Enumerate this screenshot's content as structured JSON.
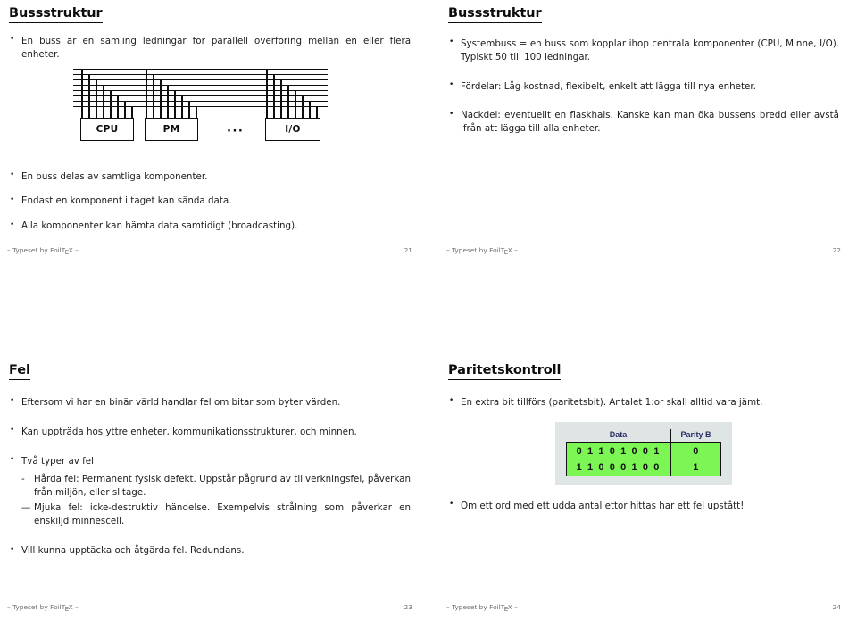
{
  "slides": [
    {
      "id": "bussstruktur-1",
      "title": "Bussstruktur",
      "bullets": [
        "En buss är en samling ledningar för parallell överföring mellan en eller flera enheter.",
        "En buss delas av samtliga komponenter.",
        "Endast en komponent i taget kan sända data.",
        "Alla komponenter kan hämta data samtidigt (broadcasting)."
      ],
      "diagram": {
        "boxes": [
          "CPU",
          "PM",
          "I/O"
        ],
        "ellipsis": "···",
        "line_count": 8
      },
      "footer_text": "Typeset by FoilT",
      "footer_dash": "–",
      "page_number": "21"
    },
    {
      "id": "bussstruktur-2",
      "title": "Bussstruktur",
      "bullets": [
        "Systembuss = en buss som kopplar ihop centrala komponenter (CPU, Minne, I/O). Typiskt 50 till 100 ledningar.",
        "Fördelar: Låg kostnad, flexibelt, enkelt att lägga till nya enheter.",
        "Nackdel: eventuellt en flaskhals. Kanske kan man öka bussens bredd eller avstå ifrån att lägga till alla enheter."
      ],
      "footer_text": "Typeset by FoilT",
      "footer_dash": "–",
      "page_number": "22"
    },
    {
      "id": "fel",
      "title": "Fel",
      "bullets": [
        "Eftersom vi har en binär värld handlar fel om bitar som byter värden.",
        "Kan uppträda hos yttre enheter, kommunikationsstrukturer, och minnen.",
        "Två typer av fel",
        "Vill kunna upptäcka och åtgärda fel. Redundans."
      ],
      "sub_bullets": [
        {
          "marker": "-",
          "text": "Hårda fel: Permanent fysisk defekt. Uppstår pågrund av tillverkningsfel, påverkan från miljön, eller slitage."
        },
        {
          "marker": "—",
          "text": "Mjuka fel: icke-destruktiv händelse. Exempelvis strålning som påverkar en enskiljd minnescell."
        }
      ],
      "footer_text": "Typeset by FoilT",
      "footer_dash": "–",
      "page_number": "23"
    },
    {
      "id": "paritetskontroll",
      "title": "Paritetskontroll",
      "bullets": [
        "En extra bit tillförs (paritetsbit). Antalet 1:or skall alltid vara jämt.",
        "Om ett ord med ett udda antal ettor hittas har ett fel upstått!"
      ],
      "table": {
        "headers": [
          "Data",
          "Parity B"
        ],
        "rows": [
          {
            "data": "0 1 1 0 1 0 0 1",
            "parity": "0"
          },
          {
            "data": "1 1 0 0 0 1 0 0",
            "parity": "1"
          }
        ],
        "colors": {
          "panel_background": "#dfe5e5",
          "cell_background": "#7cf655",
          "header_text": "#2b2b66",
          "border": "#111111"
        }
      },
      "footer_text": "Typeset by FoilT",
      "footer_dash": "–",
      "page_number": "24"
    }
  ]
}
